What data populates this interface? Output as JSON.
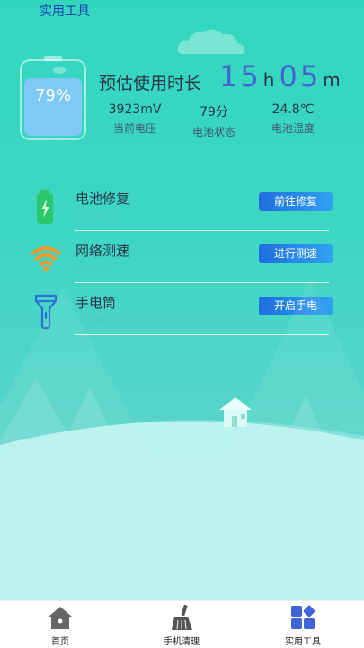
{
  "header": {
    "title": "实用工具"
  },
  "battery": {
    "percent": "79%",
    "estimate_label": "预估使用时长",
    "hours": "15",
    "hours_unit": "h",
    "minutes": "05",
    "minutes_unit": "m",
    "level_fraction": 0.79
  },
  "stats": [
    {
      "value": "3923mV",
      "label": "当前电压"
    },
    {
      "value": "79分",
      "label": "电池状态"
    },
    {
      "value": "24.8℃",
      "label": "电池温度"
    }
  ],
  "tools": [
    {
      "name": "电池修复",
      "desc": "电池修复",
      "button": "前往修复",
      "icon": "battery-repair-icon"
    },
    {
      "name": "网络测速",
      "desc": "网络测速",
      "button": "进行测速",
      "icon": "wifi-speed-icon"
    },
    {
      "name": "手电筒",
      "desc": "手电筒",
      "button": "开启手电",
      "icon": "flashlight-icon"
    }
  ],
  "nav": [
    {
      "label": "首页",
      "icon": "home-icon"
    },
    {
      "label": "手机清理",
      "icon": "broom-icon"
    },
    {
      "label": "实用工具",
      "icon": "tools-grid-icon"
    }
  ],
  "colors": {
    "accent": "#4663cf",
    "button": "#1f6ee0",
    "background": "#31d7bd",
    "nav_active": "#3f63d9"
  }
}
